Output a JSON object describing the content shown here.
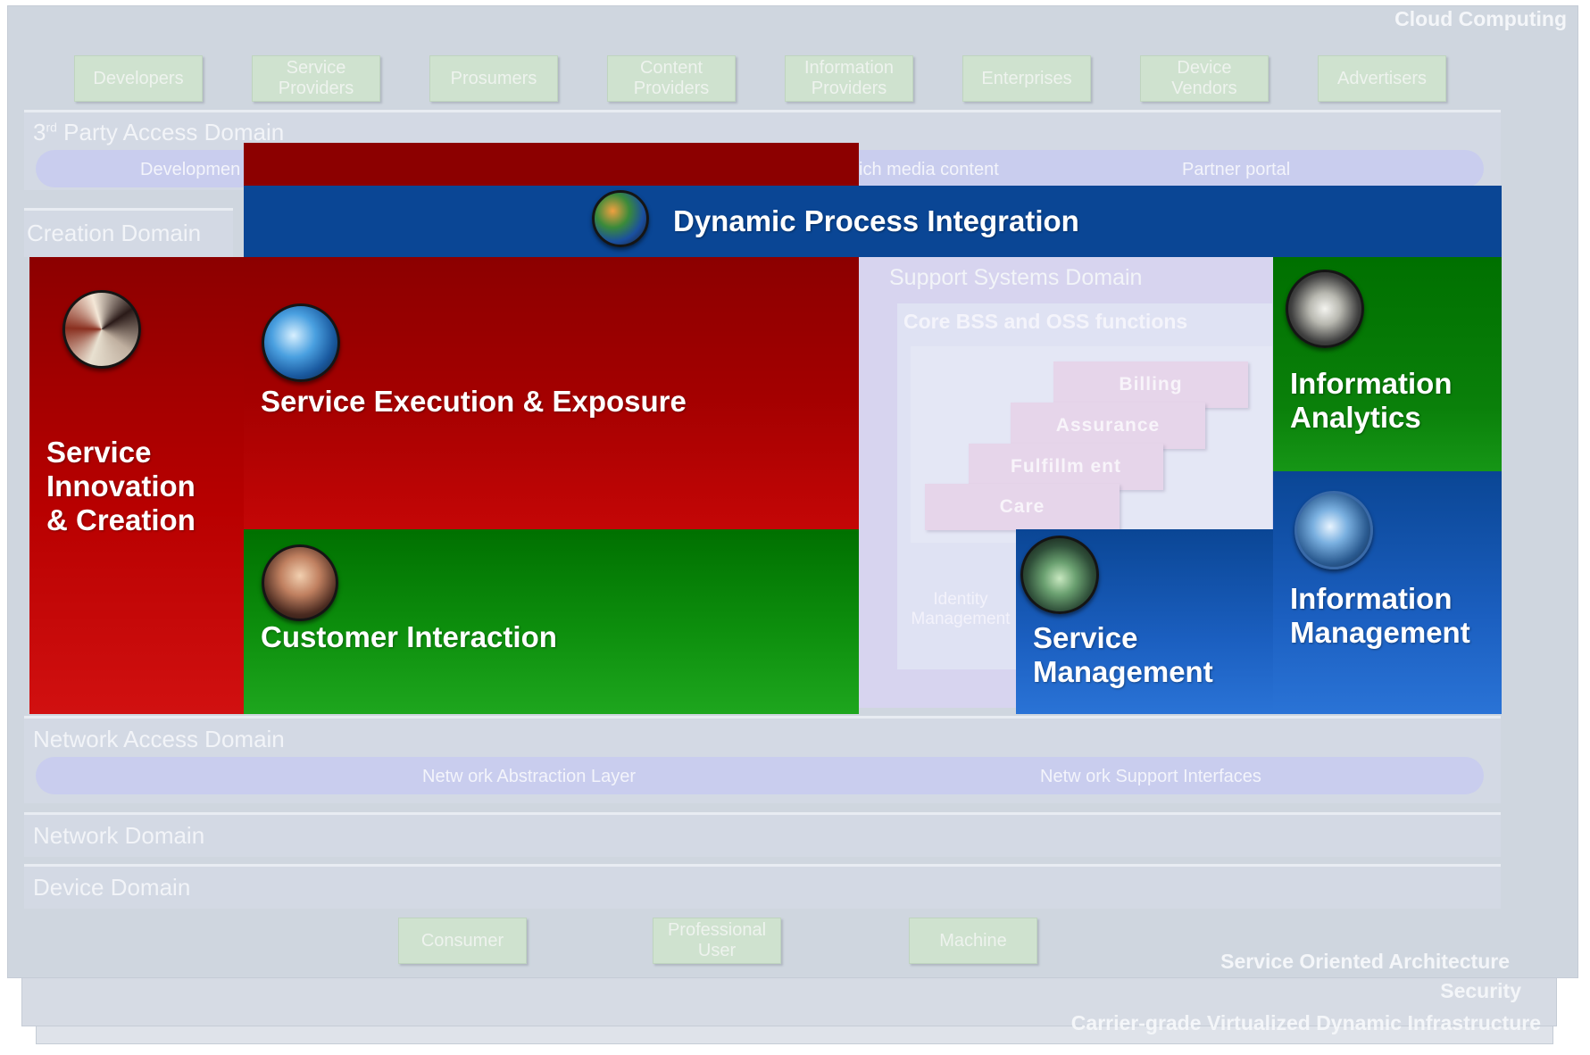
{
  "header": {
    "title": "Cloud Computing"
  },
  "stakeholders": [
    "Developers",
    "Service\nProviders",
    "Prosumers",
    "Content\nProviders",
    "Information\nProviders",
    "Enterprises",
    "Device\nVendors",
    "Advertisers"
  ],
  "third_party": {
    "label_main": "3",
    "label_sup": "rd",
    "label_rest": " Party Access Domain",
    "items": [
      "Developmen",
      "ich media content",
      "Partner portal"
    ]
  },
  "dynamic_process": {
    "label": "Dynamic Process Integration"
  },
  "creation_domain": {
    "label": "Creation Domain"
  },
  "service_innovation": {
    "label": "Service\nInnovation\n& Creation"
  },
  "service_execution": {
    "label": "Service Execution & Exposure"
  },
  "customer_interaction": {
    "label": "Customer Interaction"
  },
  "support_systems": {
    "label": "Support Systems Domain",
    "core_label": "Core BSS and OSS functions",
    "steps": [
      "Billing",
      "Assurance",
      "Fulfillm ent",
      "Care"
    ],
    "identity": "Identity\nManagement"
  },
  "service_management": {
    "label": "Service\nManagement"
  },
  "information_analytics": {
    "label": "Information\nAnalytics"
  },
  "information_management": {
    "label": "Information\nManagement"
  },
  "network_access": {
    "label": "Network Access Domain",
    "items": [
      "Netw ork Abstraction Layer",
      "Netw ork Support Interfaces"
    ]
  },
  "network_domain": {
    "label": "Network Domain"
  },
  "device_domain": {
    "label": "Device Domain"
  },
  "devices": [
    "Consumer",
    "Professional\nUser",
    "Machine"
  ],
  "footer": {
    "soa": "Service Oriented Architecture",
    "security": "Security",
    "infrastructure": "Carrier-grade Virtualized Dynamic Infrastructure"
  },
  "colors": {
    "red": "#8c0000",
    "green": "#007000",
    "blue": "#0a4695"
  }
}
